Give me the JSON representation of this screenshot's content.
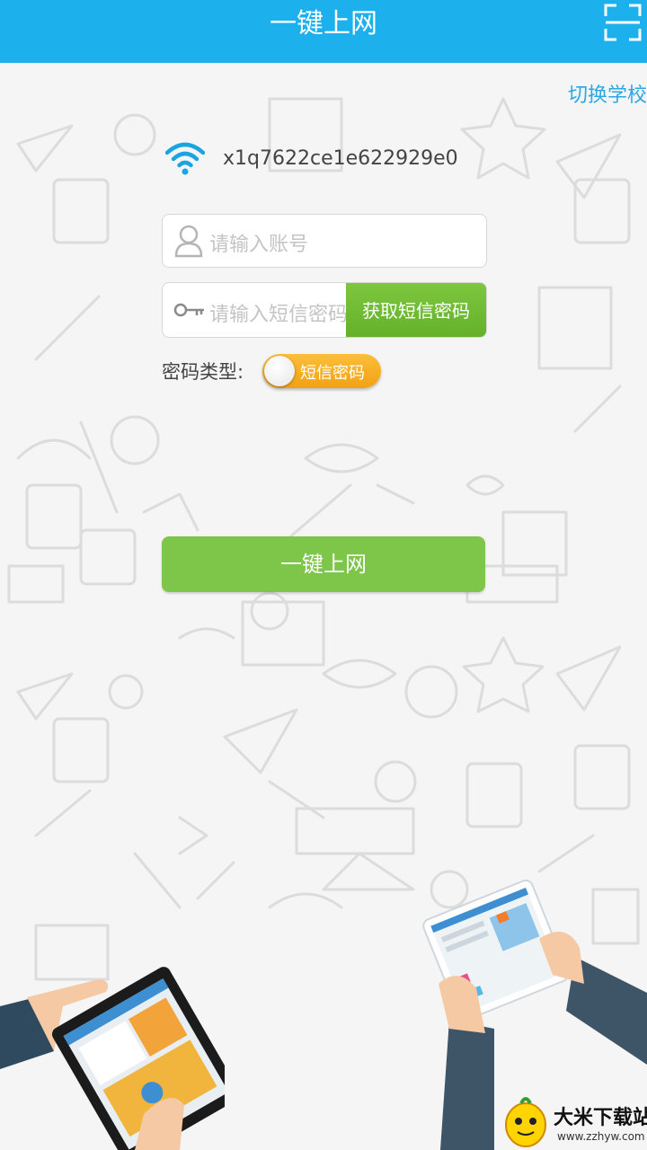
{
  "header": {
    "title": "一键上网",
    "scan_icon": "scan-icon"
  },
  "switch_school_label": "切换学校",
  "network": {
    "icon": "wifi-icon",
    "ssid": "x1q7622ce1e622929e0"
  },
  "account_field": {
    "icon": "user-icon",
    "placeholder": "请输入账号"
  },
  "sms_field": {
    "icon": "key-icon",
    "placeholder": "请输入短信密码",
    "get_code_label": "获取短信密码"
  },
  "password_type": {
    "label": "密码类型:",
    "value": "短信密码"
  },
  "connect_button_label": "一键上网",
  "watermark": {
    "name": "大米下载站",
    "url": "www.zzhyw.com"
  },
  "colors": {
    "header": "#1cb1ec",
    "green": "#7ec64a",
    "toggle": "#f2a114",
    "link": "#2aa7e6"
  }
}
